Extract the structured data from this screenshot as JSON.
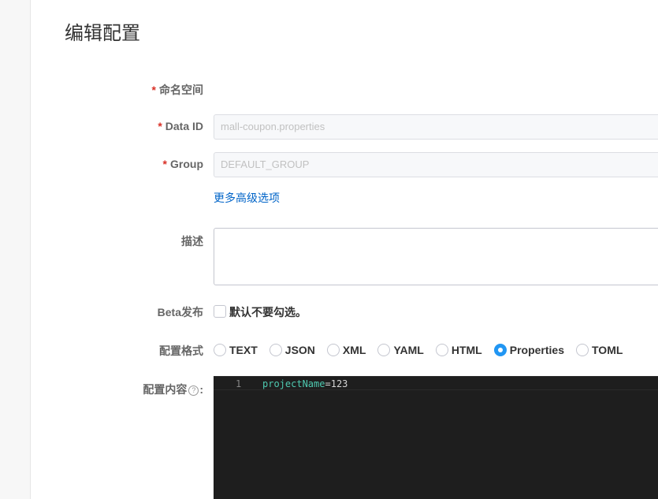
{
  "page": {
    "title": "编辑配置"
  },
  "form": {
    "namespace": {
      "label": "命名空间",
      "required_mark": "*"
    },
    "data_id": {
      "label": "Data ID",
      "required_mark": "*",
      "value": "mall-coupon.properties"
    },
    "group": {
      "label": "Group",
      "required_mark": "*",
      "value": "DEFAULT_GROUP"
    },
    "advanced_link": "更多高级选项",
    "description": {
      "label": "描述",
      "value": ""
    },
    "beta": {
      "label": "Beta发布",
      "checkbox_label": "默认不要勾选。",
      "checked": false
    },
    "format": {
      "label": "配置格式",
      "options": [
        "TEXT",
        "JSON",
        "XML",
        "YAML",
        "HTML",
        "Properties",
        "TOML"
      ],
      "selected": "Properties"
    },
    "content": {
      "label": "配置内容",
      "help_icon": "?",
      "colon": ":",
      "line_number": "1",
      "code_key": "projectName",
      "code_eq": "=",
      "code_value": "123"
    }
  },
  "colors": {
    "accent": "#2196f3",
    "link": "#0064c8",
    "required": "#d93026",
    "editor_bg": "#1e1e1e"
  }
}
